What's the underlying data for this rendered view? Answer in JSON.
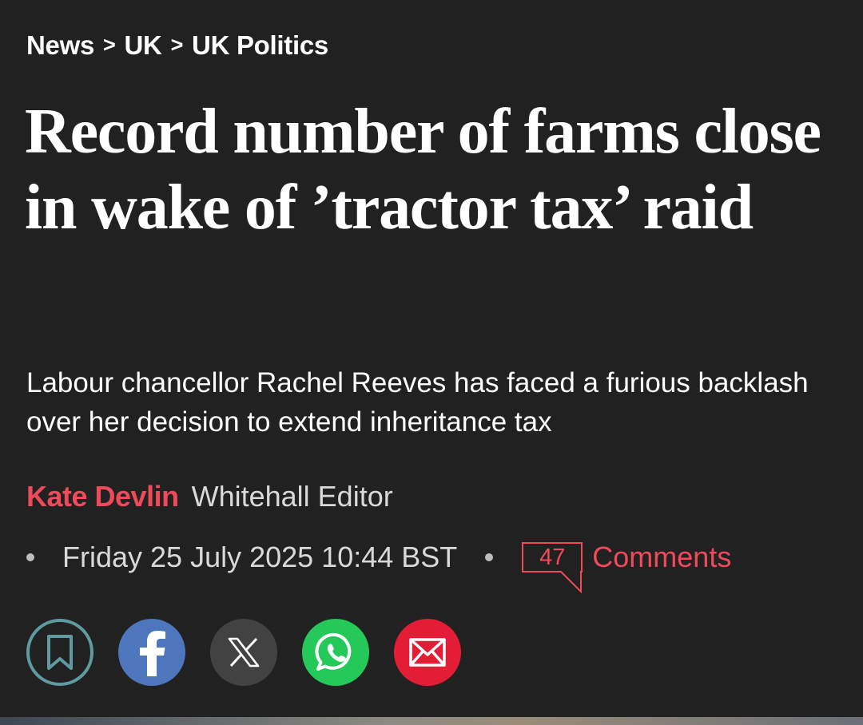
{
  "breadcrumb": {
    "items": [
      "News",
      "UK",
      "UK Politics"
    ],
    "separator": ">"
  },
  "article": {
    "headline": "Record number of farms close in wake of ’tractor tax’ raid",
    "standfirst": "Labour chancellor Rachel Reeves has faced a furious backlash over her decision to extend inheritance tax",
    "author": "Kate Devlin",
    "author_role": "Whitehall Editor",
    "published": "Friday 25 July 2025 10:44 BST",
    "comment_count": "47",
    "comments_label": "Comments"
  },
  "share": {
    "buttons": [
      "bookmark-icon",
      "facebook-icon",
      "x-icon",
      "whatsapp-icon",
      "email-icon"
    ]
  },
  "colors": {
    "background": "#212121",
    "accent": "#ee4a5a",
    "facebook": "#4d76bd",
    "whatsapp": "#25c95a",
    "email": "#e31d36",
    "bookmark_ring": "#5e9aa0"
  }
}
